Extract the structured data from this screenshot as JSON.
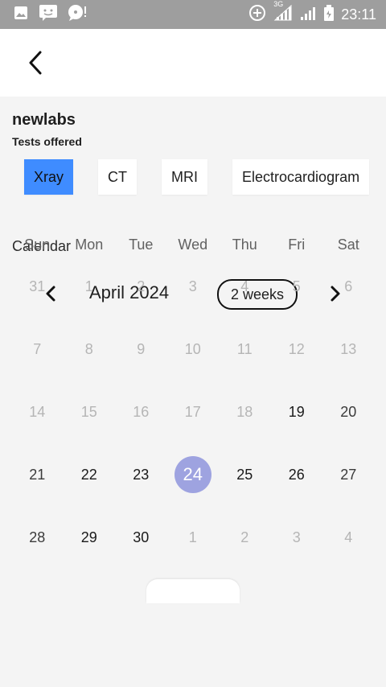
{
  "status_bar": {
    "time": "23:11",
    "network": "3G",
    "icons_left": [
      "image-icon",
      "message-icon",
      "chat-alert-icon"
    ],
    "icons_right": [
      "data-saver-icon",
      "signal-icon",
      "signal-icon-2",
      "battery-icon"
    ]
  },
  "app_bar": {
    "back_icon": "chevron-left-icon"
  },
  "lab": {
    "name": "newlabs",
    "tests_title": "Tests offered",
    "tests": [
      {
        "label": "Xray",
        "selected": true
      },
      {
        "label": "CT",
        "selected": false
      },
      {
        "label": "MRI",
        "selected": false
      },
      {
        "label": "Electrocardiogram",
        "selected": false
      }
    ]
  },
  "calendar": {
    "section_title": "Calendar",
    "month_label": "April 2024",
    "format_label": "2 weeks",
    "weekdays": [
      "Sun",
      "Mon",
      "Tue",
      "Wed",
      "Thu",
      "Fri",
      "Sat"
    ],
    "weeks": [
      [
        "31",
        "1",
        "2",
        "3",
        "4",
        "5",
        "6"
      ],
      [
        "7",
        "8",
        "9",
        "10",
        "11",
        "12",
        "13"
      ],
      [
        "14",
        "15",
        "16",
        "17",
        "18",
        "19",
        "20"
      ],
      [
        "21",
        "22",
        "23",
        "24",
        "25",
        "26",
        "27"
      ],
      [
        "28",
        "29",
        "30",
        "1",
        "2",
        "3",
        "4"
      ]
    ],
    "selected_day": "24",
    "colors": {
      "selected_circle": "#9ea3e0",
      "chip_selected": "#3f8cff",
      "disabled_text": "#b5b5b5"
    }
  }
}
